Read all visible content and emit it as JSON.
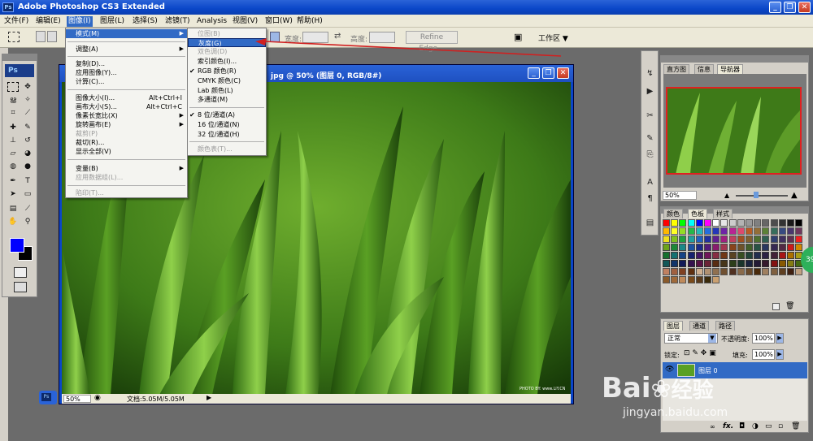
{
  "app": {
    "title": "Adobe Photoshop CS3 Extended",
    "icon": "Ps"
  },
  "window_controls": {
    "minimize": "_",
    "restore": "❐",
    "close": "✕"
  },
  "menubar": [
    {
      "label": "文件(F)"
    },
    {
      "label": "编辑(E)"
    },
    {
      "label": "图像(I)",
      "active": true
    },
    {
      "label": "图层(L)"
    },
    {
      "label": "选择(S)"
    },
    {
      "label": "滤镜(T)"
    },
    {
      "label": "Analysis"
    },
    {
      "label": "视图(V)"
    },
    {
      "label": "窗口(W)"
    },
    {
      "label": "帮助(H)"
    }
  ],
  "optionsbar": {
    "width_label": "宽度:",
    "height_label": "高度:",
    "refine_edge": "Refine Edge...",
    "workspace": "工作区 ▼"
  },
  "document": {
    "title": "jpg @ 50% (图层 0, RGB/8#)",
    "zoom": "50%",
    "doc_info": "文档:5.05M/5.05M",
    "watermark": "PHOTO BY: www.LiY.CN"
  },
  "image_menu": {
    "items": [
      {
        "label": "模式(M)",
        "highlight": true,
        "submenu": true
      },
      {
        "sep": true
      },
      {
        "label": "调整(A)",
        "submenu": true
      },
      {
        "sep": true
      },
      {
        "label": "复制(D)..."
      },
      {
        "label": "应用图像(Y)..."
      },
      {
        "label": "计算(C)..."
      },
      {
        "sep": true
      },
      {
        "label": "图像大小(I)...",
        "shortcut": "Alt+Ctrl+I"
      },
      {
        "label": "画布大小(S)...",
        "shortcut": "Alt+Ctrl+C"
      },
      {
        "label": "像素长宽比(X)",
        "submenu": true
      },
      {
        "label": "旋转画布(E)",
        "submenu": true
      },
      {
        "label": "裁剪(P)",
        "disabled": true
      },
      {
        "label": "裁切(R)..."
      },
      {
        "label": "显示全部(V)"
      },
      {
        "sep": true
      },
      {
        "label": "变量(B)",
        "submenu": true
      },
      {
        "label": "应用数据组(L)...",
        "disabled": true
      },
      {
        "sep": true
      },
      {
        "label": "陷印(T)...",
        "disabled": true
      }
    ]
  },
  "mode_menu": {
    "items": [
      {
        "label": "位图(B)",
        "disabled": true
      },
      {
        "label": "灰度(G)",
        "highlight": true
      },
      {
        "label": "双色调(D)",
        "disabled": true
      },
      {
        "label": "索引颜色(I)..."
      },
      {
        "label": "RGB 颜色(R)",
        "checked": true
      },
      {
        "label": "CMYK 颜色(C)"
      },
      {
        "label": "Lab 颜色(L)"
      },
      {
        "label": "多通道(M)"
      },
      {
        "sep": true
      },
      {
        "label": "8 位/通道(A)",
        "checked": true
      },
      {
        "label": "16 位/通道(N)"
      },
      {
        "label": "32 位/通道(H)"
      },
      {
        "sep": true
      },
      {
        "label": "颜色表(T)...",
        "disabled": true
      }
    ]
  },
  "navigator": {
    "tabs": [
      "直方图",
      "信息",
      "导航器"
    ],
    "zoom": "50%"
  },
  "swatches": {
    "tabs": [
      "颜色",
      "色板",
      "样式"
    ]
  },
  "layers": {
    "tabs": [
      "图层",
      "通道",
      "路径"
    ],
    "blend": "正常",
    "opacity_label": "不透明度:",
    "opacity": "100%",
    "lock_label": "锁定:",
    "fill_label": "填充:",
    "fill": "100%",
    "layer_name": "图层 0",
    "fx": "fx."
  },
  "watermark": {
    "brand": "Bai",
    "brand2": "经验",
    "url": "jingyan.baidu.com"
  },
  "badge": "39",
  "colors": {
    "accent": "#316ac5",
    "foreground": "#0000ff",
    "background": "#000000"
  }
}
